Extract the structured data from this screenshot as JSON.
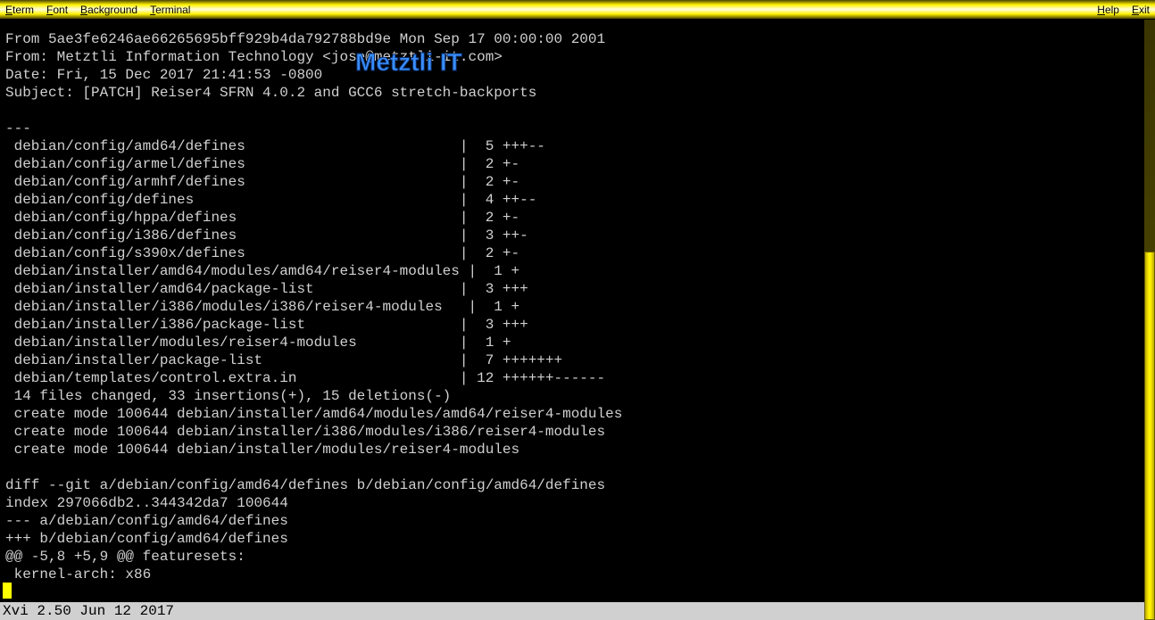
{
  "menu": {
    "left": [
      "Eterm",
      "Font",
      "Background",
      "Terminal"
    ],
    "right": [
      "Help",
      "Exit"
    ]
  },
  "watermark": "Metztli IT",
  "statusbar": "Xvi 2.50 Jun 12 2017",
  "terminal_lines": [
    "From 5ae3fe6246ae66265695bff929b4da792788bd9e Mon Sep 17 00:00:00 2001",
    "From: Metztli Information Technology <jose@metztli-it.com>",
    "Date: Fri, 15 Dec 2017 21:41:53 -0800",
    "Subject: [PATCH] Reiser4 SFRN 4.0.2 and GCC6 stretch-backports",
    "",
    "---",
    " debian/config/amd64/defines                         |  5 +++--",
    " debian/config/armel/defines                         |  2 +-",
    " debian/config/armhf/defines                         |  2 +-",
    " debian/config/defines                               |  4 ++--",
    " debian/config/hppa/defines                          |  2 +-",
    " debian/config/i386/defines                          |  3 ++-",
    " debian/config/s390x/defines                         |  2 +-",
    " debian/installer/amd64/modules/amd64/reiser4-modules |  1 +",
    " debian/installer/amd64/package-list                 |  3 +++",
    " debian/installer/i386/modules/i386/reiser4-modules   |  1 +",
    " debian/installer/i386/package-list                  |  3 +++",
    " debian/installer/modules/reiser4-modules            |  1 +",
    " debian/installer/package-list                       |  7 +++++++",
    " debian/templates/control.extra.in                   | 12 ++++++------",
    " 14 files changed, 33 insertions(+), 15 deletions(-)",
    " create mode 100644 debian/installer/amd64/modules/amd64/reiser4-modules",
    " create mode 100644 debian/installer/i386/modules/i386/reiser4-modules",
    " create mode 100644 debian/installer/modules/reiser4-modules",
    "",
    "diff --git a/debian/config/amd64/defines b/debian/config/amd64/defines",
    "index 297066db2..344342da7 100644",
    "--- a/debian/config/amd64/defines",
    "+++ b/debian/config/amd64/defines",
    "@@ -5,8 +5,9 @@ featuresets:",
    " kernel-arch: x86"
  ]
}
